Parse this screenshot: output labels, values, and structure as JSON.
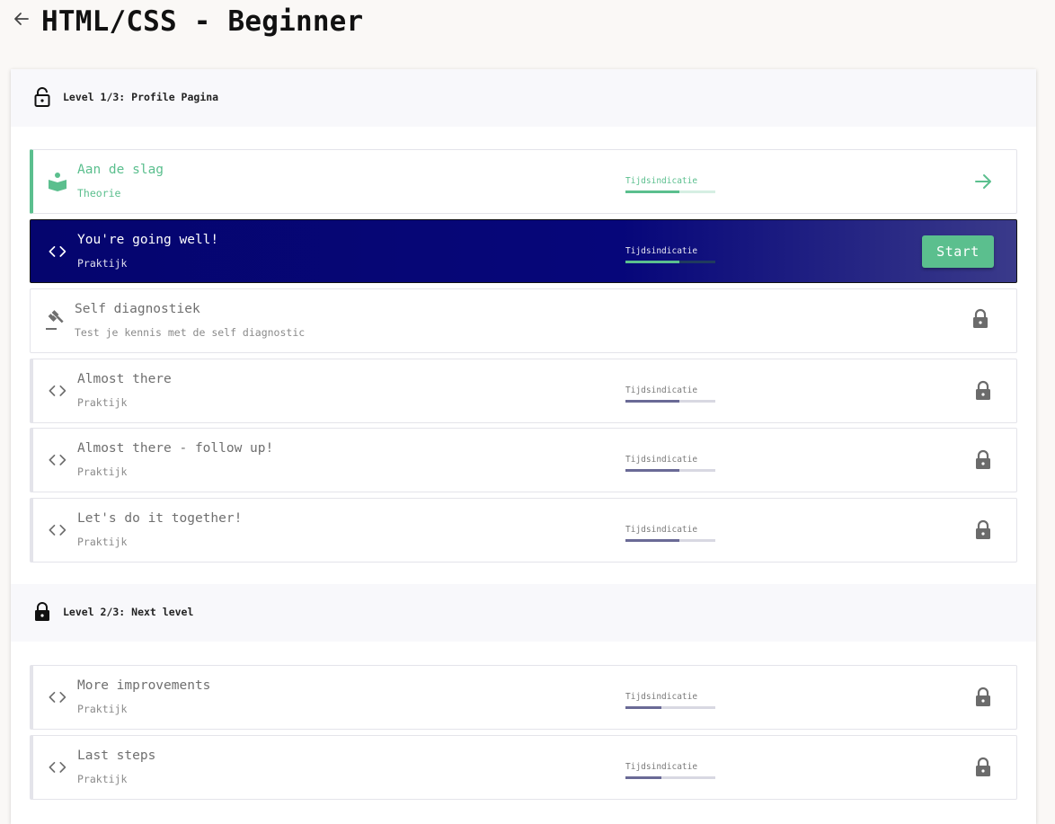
{
  "header": {
    "title": "HTML/CSS - Beginner"
  },
  "levels": [
    {
      "label": "Level 1/3: Profile Pagina",
      "locked": false
    },
    {
      "label": "Level 2/3: Next level",
      "locked": true
    }
  ],
  "items": [
    {
      "title": "Aan de slag",
      "subtitle": "Theorie",
      "time_label": "Tijdsindicatie",
      "time_fraction": 0.6,
      "state": "completed"
    },
    {
      "title": "You're going well!",
      "subtitle": "Praktijk",
      "time_label": "Tijdsindicatie",
      "time_fraction": 0.6,
      "state": "active",
      "action_label": "Start"
    },
    {
      "title": "Self diagnostiek",
      "subtitle": "Test je kennis met de self diagnostic",
      "state": "locked"
    },
    {
      "title": "Almost there",
      "subtitle": "Praktijk",
      "time_label": "Tijdsindicatie",
      "time_fraction": 0.6,
      "state": "locked"
    },
    {
      "title": "Almost there - follow up!",
      "subtitle": "Praktijk",
      "time_label": "Tijdsindicatie",
      "time_fraction": 0.6,
      "state": "locked"
    },
    {
      "title": "Let's do it together!",
      "subtitle": "Praktijk",
      "time_label": "Tijdsindicatie",
      "time_fraction": 0.6,
      "state": "locked"
    },
    {
      "title": "More improvements",
      "subtitle": "Praktijk",
      "time_label": "Tijdsindicatie",
      "time_fraction": 0.4,
      "state": "locked"
    },
    {
      "title": "Last steps",
      "subtitle": "Praktijk",
      "time_label": "Tijdsindicatie",
      "time_fraction": 0.4,
      "state": "locked"
    }
  ],
  "colors": {
    "accent": "#5bbf8e",
    "active_bg": "#06067a",
    "progress": "#6a6a96"
  }
}
